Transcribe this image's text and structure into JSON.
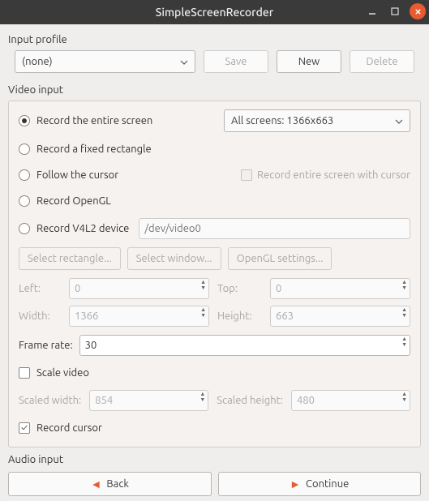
{
  "window": {
    "title": "SimpleScreenRecorder"
  },
  "input_profile": {
    "label": "Input profile",
    "selected": "(none)",
    "save": "Save",
    "new": "New",
    "delete": "Delete"
  },
  "video_input": {
    "label": "Video input",
    "radios": {
      "entire_screen": "Record the entire screen",
      "fixed_rect": "Record a fixed rectangle",
      "follow_cursor": "Follow the cursor",
      "opengl": "Record OpenGL",
      "v4l2": "Record V4L2 device"
    },
    "screens_combo": "All screens: 1366x663",
    "record_entire_with_cursor": "Record entire screen with cursor",
    "v4l2_placeholder": "/dev/video0",
    "buttons": {
      "select_rect": "Select rectangle...",
      "select_window": "Select window...",
      "opengl_settings": "OpenGL settings..."
    },
    "dims": {
      "left_label": "Left:",
      "left": "0",
      "top_label": "Top:",
      "top": "0",
      "width_label": "Width:",
      "width": "1366",
      "height_label": "Height:",
      "height": "663"
    },
    "framerate_label": "Frame rate:",
    "framerate": "30",
    "scale_video": "Scale video",
    "scaled_width_label": "Scaled width:",
    "scaled_width": "854",
    "scaled_height_label": "Scaled height:",
    "scaled_height": "480",
    "record_cursor": "Record cursor"
  },
  "audio_input": {
    "label": "Audio input"
  },
  "footer": {
    "back": "Back",
    "continue": "Continue"
  }
}
